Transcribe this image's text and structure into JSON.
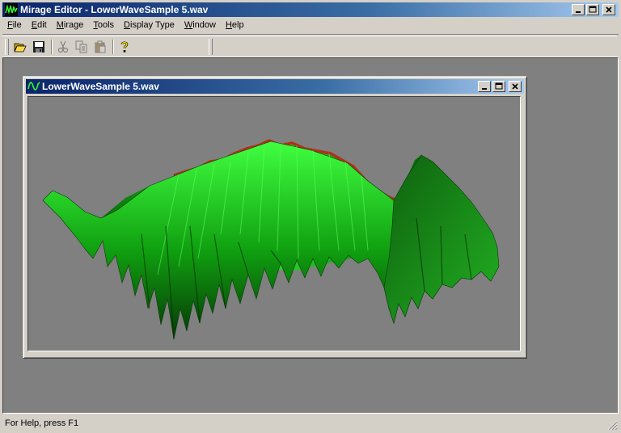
{
  "app": {
    "title": "Mirage Editor - LowerWaveSample 5.wav"
  },
  "menu": [
    {
      "label": "File",
      "accel": "F",
      "rest": "ile"
    },
    {
      "label": "Edit",
      "accel": "E",
      "rest": "dit"
    },
    {
      "label": "Mirage",
      "accel": "M",
      "rest": "irage"
    },
    {
      "label": "Tools",
      "accel": "T",
      "rest": "ools"
    },
    {
      "label": "Display Type",
      "accel": "D",
      "rest": "isplay Type"
    },
    {
      "label": "Window",
      "accel": "W",
      "rest": "indow"
    },
    {
      "label": "Help",
      "accel": "H",
      "rest": "elp"
    }
  ],
  "toolbar": {
    "buttons": [
      "open-icon",
      "save-icon",
      "cut-icon",
      "copy-icon",
      "paste-icon",
      "help-icon"
    ]
  },
  "child_window": {
    "title": "LowerWaveSample 5.wav"
  },
  "status": {
    "text": "For Help, press F1"
  },
  "colors": {
    "title_start": "#0a246a",
    "title_end": "#a6caf0",
    "surface_green": "#22cc22",
    "ridge_red": "#b03018",
    "viewport_bg": "#808080"
  }
}
